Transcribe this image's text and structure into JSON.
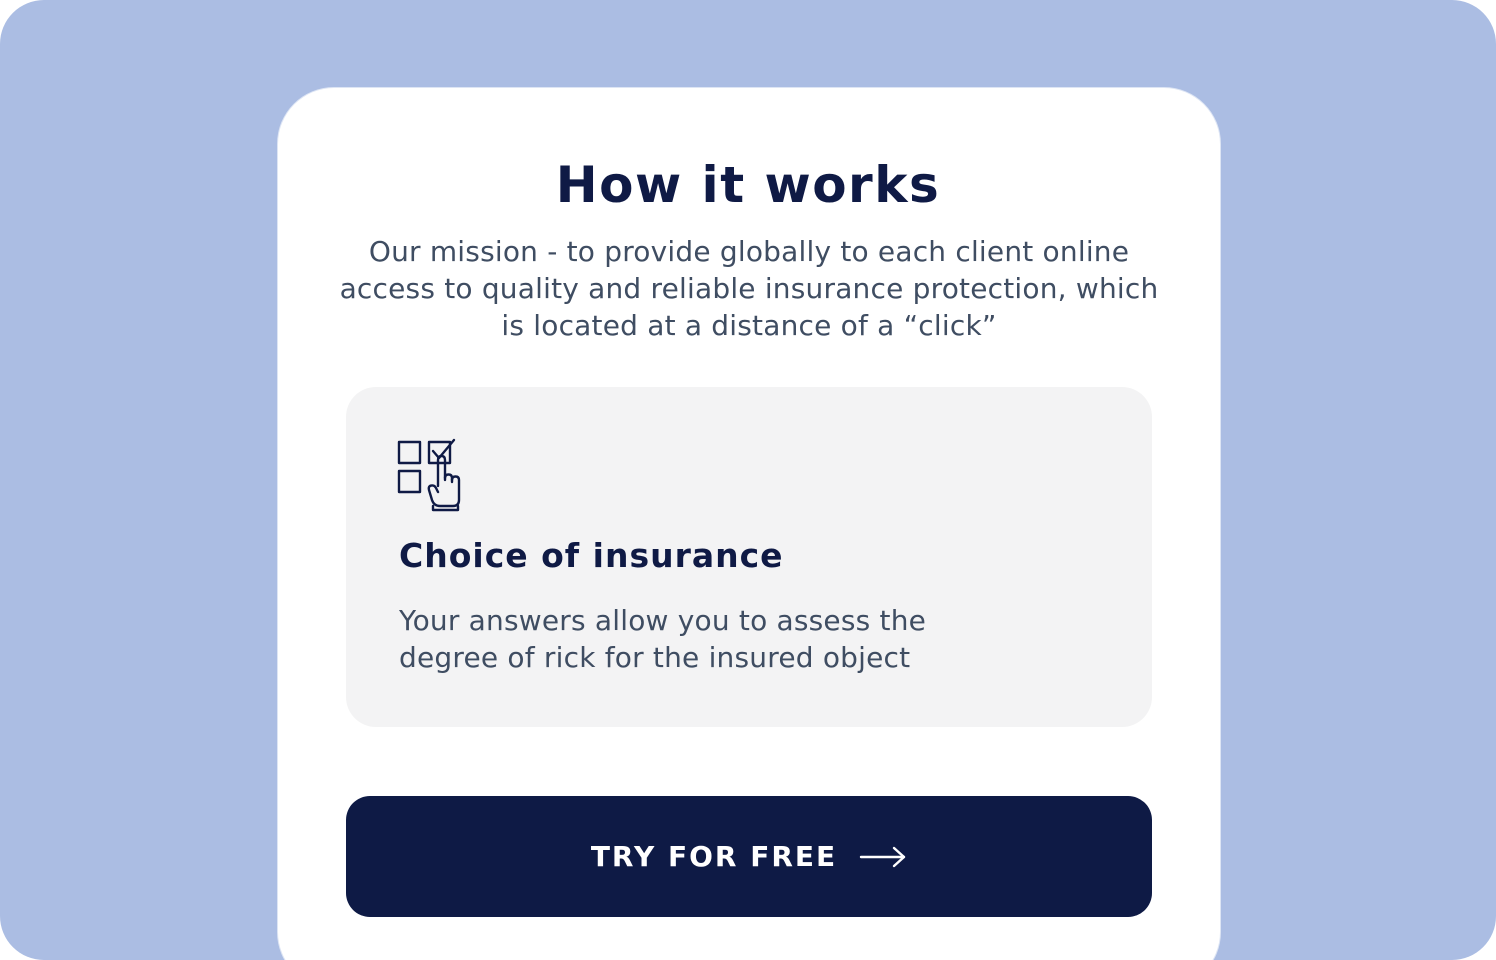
{
  "section": {
    "title": "How it works",
    "mission": "Our mission - to provide globally to each client online access to quality and reliable insurance protection, which is located at a distance of a “click”"
  },
  "feature": {
    "icon": "checklist-pointer-icon",
    "title": "Choice of insurance",
    "description": "Your answers allow you to assess the degree of rick for the insured object"
  },
  "cta": {
    "label": "TRY FOR FREE",
    "icon": "arrow-right-icon"
  },
  "colors": {
    "background": "#abbde3",
    "card": "#ffffff",
    "feature_box": "#f3f3f4",
    "primary": "#0e1a45",
    "body_text": "#3f4d62"
  }
}
